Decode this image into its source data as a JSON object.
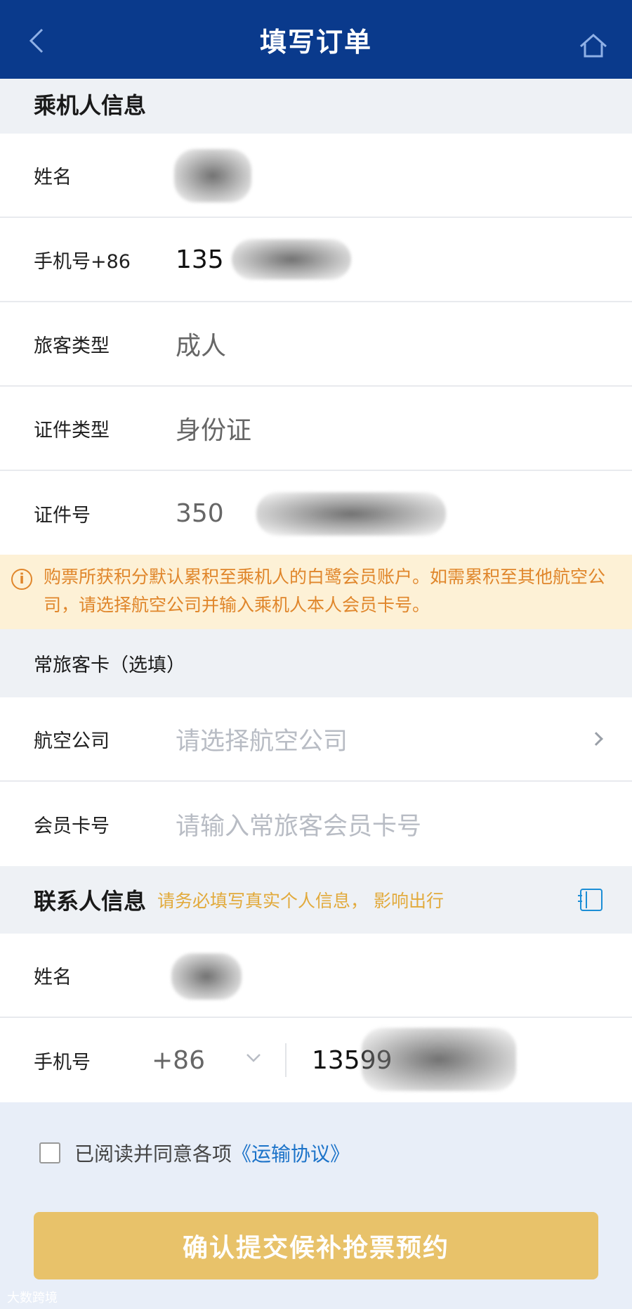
{
  "header": {
    "title": "填写订单"
  },
  "passenger_section": {
    "title": "乘机人信息",
    "name_label": "姓名",
    "phone_label": "手机号+86",
    "phone_value": "135",
    "type_label": "旅客类型",
    "type_value": "成人",
    "idtype_label": "证件类型",
    "idtype_value": "身份证",
    "idno_label": "证件号",
    "idno_value": "350"
  },
  "notice": {
    "text": "购票所获积分默认累积至乘机人的白鹭会员账户。如需累积至其他航空公司，请选择航空公司并输入乘机人本人会员卡号。"
  },
  "ffp_section": {
    "title": "常旅客卡（选填）",
    "airline_label": "航空公司",
    "airline_placeholder": "请选择航空公司",
    "card_label": "会员卡号",
    "card_placeholder": "请输入常旅客会员卡号"
  },
  "contact_section": {
    "title": "联系人信息",
    "hint": "请务必填写真实个人信息，  影响出行",
    "name_label": "姓名",
    "phone_label": "手机号",
    "country_code": "+86",
    "phone_value": "13599"
  },
  "agreement": {
    "text": "已阅读并同意各项",
    "link": "《运输协议》"
  },
  "submit": {
    "label": "确认提交候补抢票预约"
  },
  "watermark": {
    "text": "大数跨境"
  }
}
